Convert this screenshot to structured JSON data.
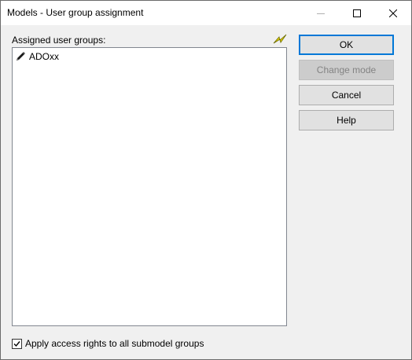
{
  "window": {
    "title": "Models - User group assignment",
    "icons": [
      "minimize-icon",
      "maximize-icon",
      "close-icon"
    ]
  },
  "groups": {
    "label": "Assigned user groups:",
    "refresh_icon": "lightning-icon",
    "items": [
      {
        "label": "ADOxx",
        "icon": "pencil-icon"
      }
    ]
  },
  "buttons": {
    "ok": "OK",
    "change_mode": "Change mode",
    "cancel": "Cancel",
    "help": "Help"
  },
  "options": {
    "apply_rights_label": "Apply access rights to all submodel groups",
    "apply_rights_checked": true
  }
}
